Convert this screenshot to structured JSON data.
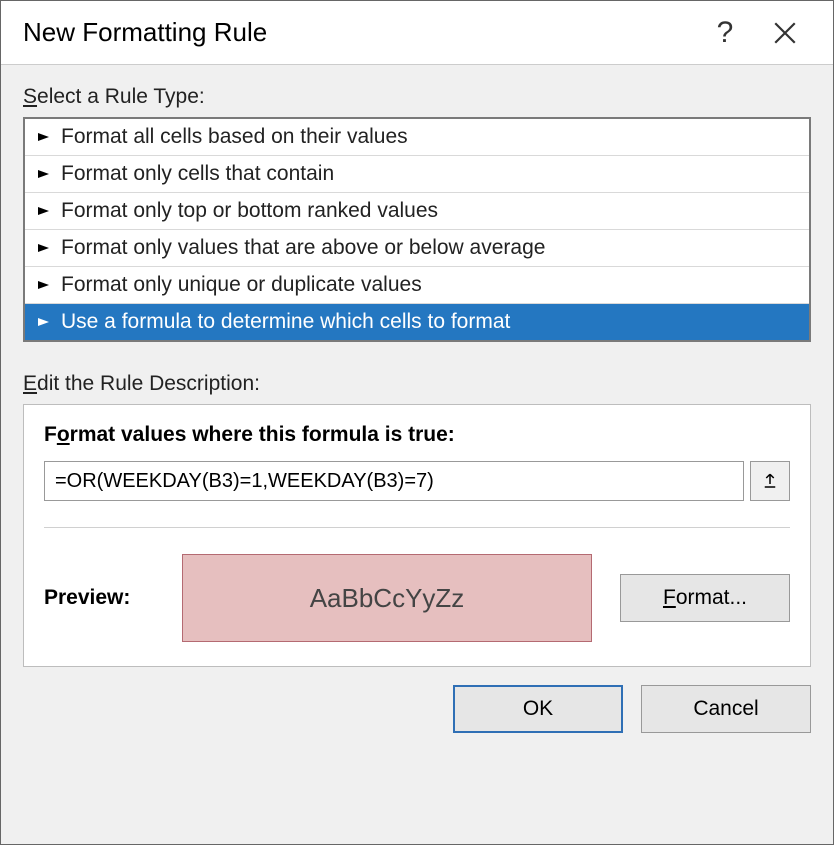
{
  "title": "New Formatting Rule",
  "select_label": "Select a Rule Type:",
  "rule_types": [
    "Format all cells based on their values",
    "Format only cells that contain",
    "Format only top or bottom ranked values",
    "Format only values that are above or below average",
    "Format only unique or duplicate values",
    "Use a formula to determine which cells to format"
  ],
  "selected_index": 5,
  "edit_label": "Edit the Rule Description:",
  "formula_heading_prefix": "F",
  "formula_heading_underlined": "o",
  "formula_heading_suffix": "rmat values where this formula is true:",
  "formula_value": "=OR(WEEKDAY(B3)=1,WEEKDAY(B3)=7)",
  "preview_label": "Preview:",
  "preview_sample": "AaBbCcYyZz",
  "format_btn_underlined": "F",
  "format_btn_suffix": "ormat...",
  "ok_label": "OK",
  "cancel_label": "Cancel",
  "help_glyph": "?"
}
